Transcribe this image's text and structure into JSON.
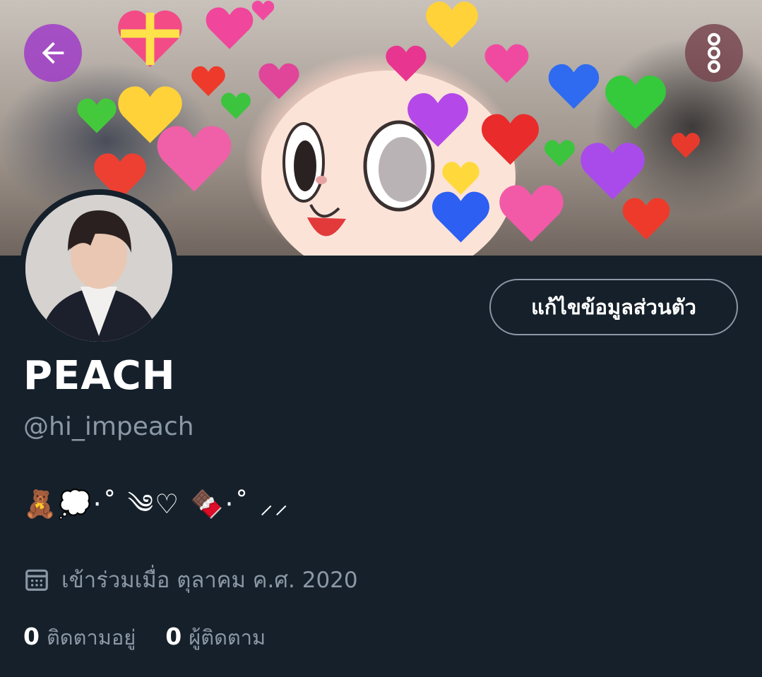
{
  "header": {
    "back_icon": "arrow-left-icon",
    "more_icon": "more-vertical-icon",
    "back_button_color": "#a03cc8",
    "more_button_color": "#784650"
  },
  "profile": {
    "display_name": "PEACH",
    "handle": "@hi_impeach",
    "bio": "🧸💭⋅˚ ༄♡ 🍫⋅˚ ⸝⸝",
    "joined_icon": "calendar-icon",
    "joined_text": "เข้าร่วมเมื่อ ตุลาคม ค.ศ. 2020",
    "edit_button_label": "แก้ไขข้อมูลส่วนตัว"
  },
  "stats": {
    "following_count": "0",
    "following_label": "ติดตามอยู่",
    "followers_count": "0",
    "followers_label": "ผู้ติดตาม"
  },
  "colors": {
    "background": "#15202b",
    "secondary_text": "#8b98a5",
    "primary_text": "#ffffff"
  }
}
